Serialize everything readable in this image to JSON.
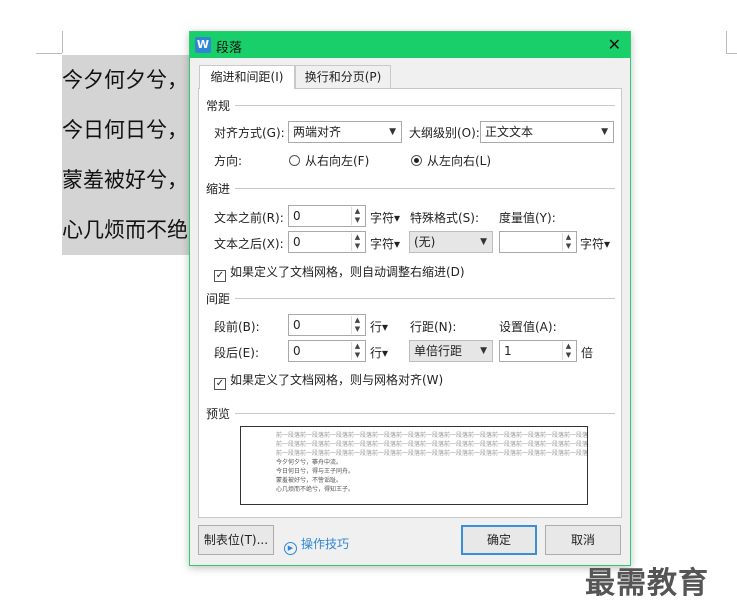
{
  "document": {
    "lines": [
      "今夕何夕兮，",
      "今日何日兮，",
      "蒙羞被好兮，",
      "心几烦而不绝"
    ]
  },
  "dialog": {
    "title": "段落",
    "app_icon_letter": "W",
    "tabs": [
      {
        "label": "缩进和间距(I)",
        "active": true
      },
      {
        "label": "换行和分页(P)",
        "active": false
      }
    ],
    "general": {
      "section_label": "常规",
      "alignment_label": "对齐方式(G):",
      "alignment_value": "两端对齐",
      "outline_label": "大纲级别(O):",
      "outline_value": "正文文本",
      "direction_label": "方向:",
      "rtl_label": "从右向左(F)",
      "ltr_label": "从左向右(L)",
      "direction_selected": "ltr"
    },
    "indent": {
      "section_label": "缩进",
      "before_label": "文本之前(R):",
      "before_value": "0",
      "before_unit": "字符▾",
      "after_label": "文本之后(X):",
      "after_value": "0",
      "after_unit": "字符▾",
      "special_label": "特殊格式(S):",
      "special_value": "(无)",
      "measure_label": "度量值(Y):",
      "measure_value": "",
      "measure_unit": "字符▾",
      "auto_adjust_label": "如果定义了文档网格，则自动调整右缩进(D)",
      "auto_adjust_checked": true
    },
    "spacing": {
      "section_label": "间距",
      "before_label": "段前(B):",
      "before_value": "0",
      "before_unit": "行▾",
      "after_label": "段后(E):",
      "after_value": "0",
      "after_unit": "行▾",
      "line_spacing_label": "行距(N):",
      "line_spacing_value": "单倍行距",
      "setting_label": "设置值(A):",
      "setting_value": "1",
      "setting_unit": "倍",
      "snap_grid_label": "如果定义了文档网格，则与网格对齐(W)",
      "snap_grid_checked": true
    },
    "preview": {
      "section_label": "预览",
      "prev_lines": [
        "前一段落前一段落前一段落前一段落前一段落前一段落前一段落前一段落前一段落前一段落前一段落前一段落前一段落",
        "前一段落前一段落前一段落前一段落前一段落前一段落前一段落前一段落前一段落前一段落前一段落前一段落前一段落",
        "前一段落前一段落前一段落前一段落前一段落前一段落前一段落前一段落前一段落前一段落前一段落前一段落前一段落"
      ],
      "sample_lines": [
        "今夕何夕兮，搴舟中流。",
        "今日何日兮，得与王子同舟。",
        "蒙羞被好兮，不訾诟耻。",
        "心几烦而不绝兮，得知王子。"
      ]
    },
    "buttons": {
      "tabs_label": "制表位(T)...",
      "tips_label": "操作技巧",
      "ok_label": "确定",
      "cancel_label": "取消"
    }
  },
  "watermark": "最需教育",
  "colors": {
    "title_bar": "#18cf6a",
    "accent": "#2f86d6"
  }
}
